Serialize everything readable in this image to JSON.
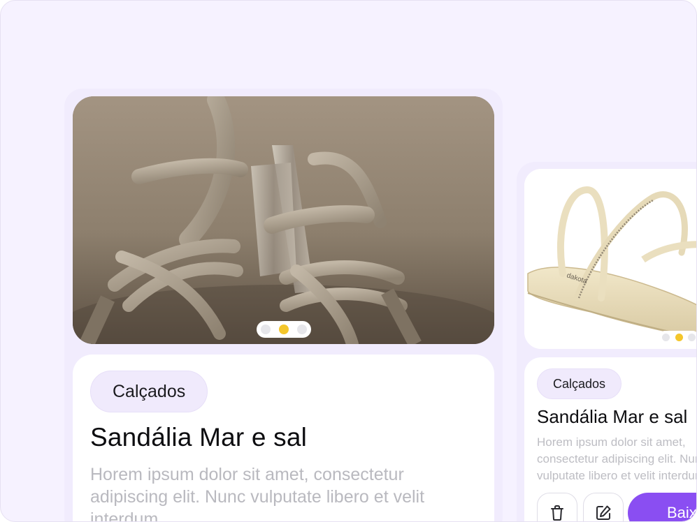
{
  "cards": [
    {
      "category": "Calçados",
      "title": "Sandália Mar e sal",
      "description": "Horem ipsum dolor sit amet, consectetur adipiscing elit. Nunc vulputate libero et velit interdum",
      "carousel": {
        "count": 3,
        "active_index": 1
      },
      "image": "strappy-high-heel-sandals-on-sand"
    },
    {
      "category": "Calçados",
      "title": "Sandália Mar e sal",
      "description": "Horem ipsum dolor sit amet, consectetur adipiscing elit. Nunc vulputate libero et velit interdum",
      "carousel": {
        "count": 3,
        "active_index": 1
      },
      "image": "cream-flat-sandal",
      "actions": {
        "delete_icon": "trash-icon",
        "edit_icon": "edit-icon",
        "primary_label": "Baixar"
      }
    }
  ],
  "colors": {
    "background": "#f6f2ff",
    "accent": "#8a4ef2",
    "chip": "#f0eafc",
    "dot_active": "#f4c62b"
  }
}
